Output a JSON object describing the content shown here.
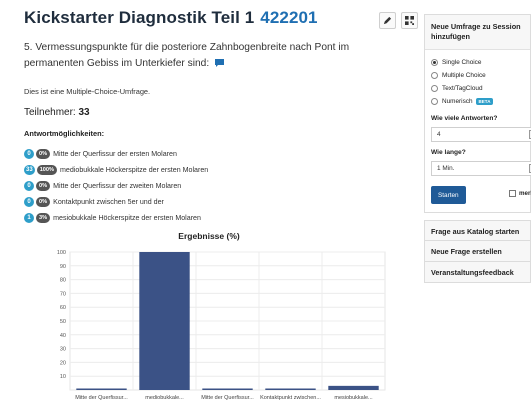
{
  "header": {
    "title": "Kickstarter Diagnostik Teil 1",
    "code": "422201"
  },
  "question": {
    "text": "5. Vermessungspunkte für die posteriore Zahnbogenbreite nach Pont im permanenten Gebiss im Unterkiefer sind:"
  },
  "info": {
    "mc_note": "Dies ist eine Multiple-Choice-Umfrage.",
    "participants_label": "Teilnehmer:",
    "participants_value": "33",
    "answers_heading": "Antwortmöglichkeiten:"
  },
  "options": [
    {
      "count": "0",
      "percent": "0%",
      "label": "Mitte der Querfissur der ersten Molaren"
    },
    {
      "count": "33",
      "percent": "100%",
      "label": "mediobukkale Höckerspitze der ersten Molaren"
    },
    {
      "count": "0",
      "percent": "0%",
      "label": "Mitte der Querfissur der zweiten Molaren"
    },
    {
      "count": "0",
      "percent": "0%",
      "label": "Kontaktpunkt zwischen 5er und der"
    },
    {
      "count": "1",
      "percent": "3%",
      "label": "mesiobukkale Höckerspitze der ersten Molaren"
    }
  ],
  "chart_data": {
    "type": "bar",
    "title": "Ergebnisse (%)",
    "categories": [
      "Mitte der Querfissur...",
      "mediobukkale...",
      "Mitte der Querfissur...",
      "Kontaktpunkt zwischen...",
      "mesiobukkale..."
    ],
    "values": [
      0,
      100,
      0,
      0,
      3
    ],
    "ylim": [
      0,
      100
    ],
    "yticks": [
      10,
      20,
      30,
      40,
      50,
      60,
      70,
      80,
      90,
      100
    ],
    "grid": true,
    "xlabel": "",
    "ylabel": ""
  },
  "sidebar": {
    "panel_title": "Neue Umfrage zu Session hinzufügen",
    "types": [
      {
        "label": "Single Choice",
        "selected": true
      },
      {
        "label": "Multiple Choice",
        "selected": false
      },
      {
        "label": "Text/TagCloud",
        "selected": false
      },
      {
        "label": "Numerisch",
        "selected": false,
        "badge": "BETA"
      }
    ],
    "answers_label": "Wie viele Antworten?",
    "answers_value": "4",
    "duration_label": "Wie lange?",
    "duration_value": "1 Min.",
    "start_label": "Starten",
    "remember_label": "merk",
    "actions": [
      "Frage aus Katalog starten",
      "Neue Frage erstellen",
      "Veranstaltungsfeedback"
    ]
  },
  "colors": {
    "bar": "#3b5286",
    "accent": "#1f6fb2",
    "badge": "#2e9ec9"
  },
  "icons": {
    "edit": "pencil-icon",
    "qr": "qr-code-icon",
    "comment": "comment-icon"
  }
}
